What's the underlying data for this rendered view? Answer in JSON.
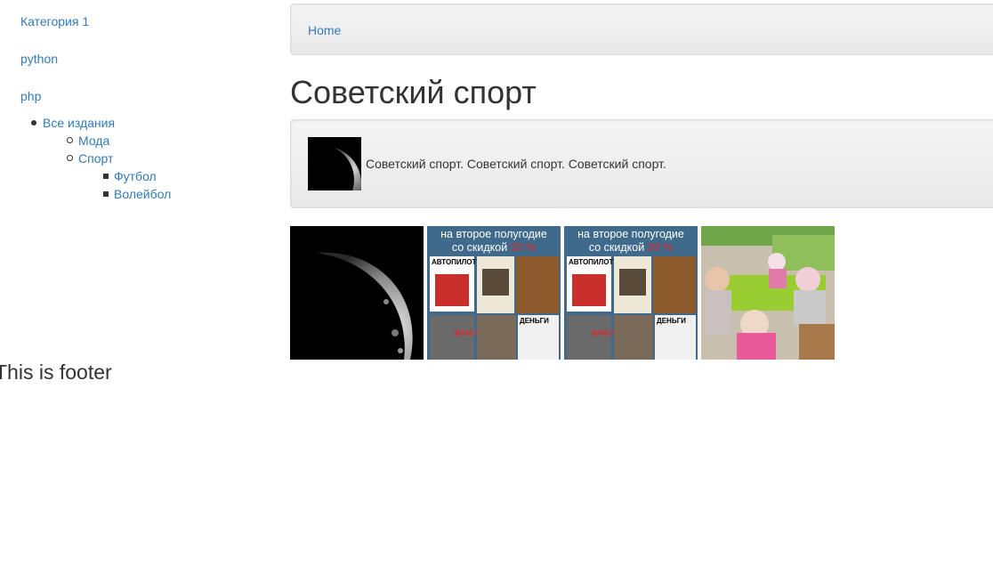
{
  "sidebar": {
    "links": [
      "Категория 1",
      "python",
      "php"
    ],
    "tree": {
      "root": "Все издания",
      "children": [
        "Мода",
        "Спорт"
      ],
      "grandchildren": [
        "Футбол",
        "Волейбол"
      ]
    }
  },
  "footer": {
    "text": "This is footer"
  },
  "breadcrumb": {
    "home": "Home"
  },
  "page": {
    "title": "Советский спорт",
    "description": "Советский спорт. Советский спорт. Советский спорт."
  },
  "gallery": {
    "magazine": {
      "headline_line1": "на второе полугодие",
      "headline_line2": "со скидкой ",
      "headline_discount": "20 %",
      "tile_labels": [
        "АВТОПИЛОТ",
        "ДЕНЬГИ",
        "ВЛАСТЬ"
      ]
    }
  },
  "colors": {
    "link": "#337ab7",
    "magazine_bg": "#3f6a8c",
    "discount_red": "#e3262b"
  }
}
